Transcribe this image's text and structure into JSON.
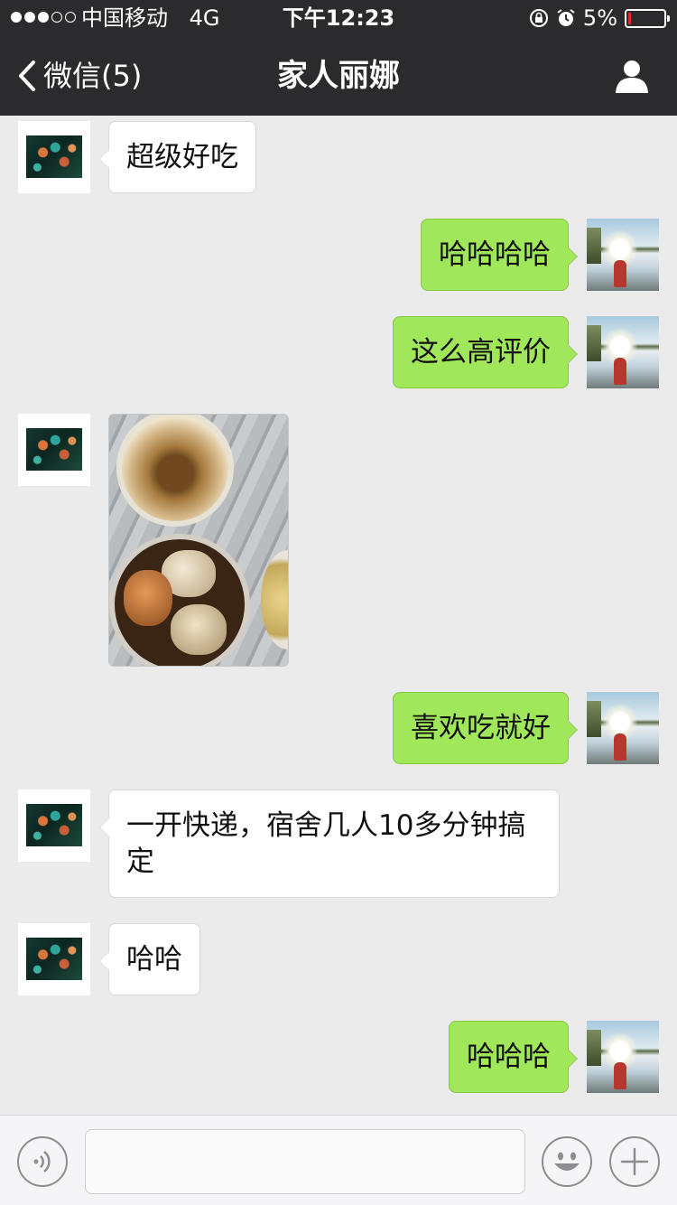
{
  "status_bar": {
    "carrier": "中国移动",
    "network": "4G",
    "time": "下午12:23",
    "battery": "5%",
    "battery_level": 0.05,
    "battery_color": "#e8262d"
  },
  "nav": {
    "back_label": "微信(5)",
    "title": "家人丽娜"
  },
  "messages": [
    {
      "sender": "contact",
      "type": "text",
      "text": "超级好吃"
    },
    {
      "sender": "me",
      "type": "text",
      "text": "哈哈哈哈"
    },
    {
      "sender": "me",
      "type": "text",
      "text": "这么高评价"
    },
    {
      "sender": "contact",
      "type": "image",
      "image": "photo of crabs in plastic containers"
    },
    {
      "sender": "me",
      "type": "text",
      "text": "喜欢吃就好"
    },
    {
      "sender": "contact",
      "type": "text",
      "text": "一开快递，宿舍几人10多分钟搞定"
    },
    {
      "sender": "contact",
      "type": "text",
      "text": "哈哈"
    },
    {
      "sender": "me",
      "type": "text",
      "text": "哈哈哈"
    }
  ],
  "input": {
    "value": "",
    "placeholder": ""
  },
  "colors": {
    "nav_background": "#2b2b2d",
    "chat_background": "#ebebeb",
    "outgoing_bubble": "#a0e75a",
    "incoming_bubble": "#ffffff"
  },
  "icons": {
    "back": "chevron-left-icon",
    "profile": "person-icon",
    "voice": "voice-icon",
    "emoji": "emoji-icon",
    "more": "plus-icon"
  }
}
